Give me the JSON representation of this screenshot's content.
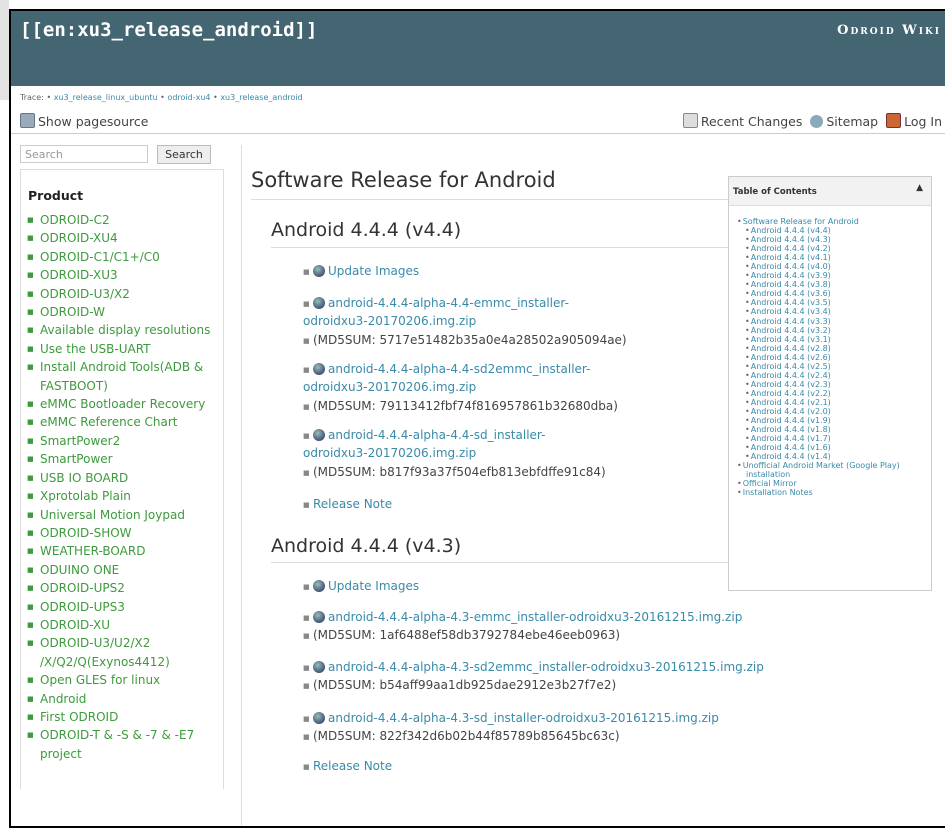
{
  "header": {
    "title": "[[en:xu3_release_android]]",
    "wiki_name": "Odroid Wiki"
  },
  "trace": {
    "label": "Trace:",
    "items": [
      "xu3_release_linux_ubuntu",
      "odroid-xu4",
      "xu3_release_android"
    ]
  },
  "toolbar": {
    "show_pagesource": "Show pagesource",
    "recent_changes": "Recent Changes",
    "sitemap": "Sitemap",
    "log_in": "Log In"
  },
  "search": {
    "placeholder": "Search",
    "button": "Search"
  },
  "sidebar": {
    "heading": "Product",
    "items": [
      "ODROID-C2",
      "ODROID-XU4",
      "ODROID-C1/C1+/C0",
      "ODROID-XU3",
      "ODROID-U3/X2",
      "ODROID-W",
      "Available display resolutions",
      "Use the USB-UART",
      "Install Android Tools(ADB & FASTBOOT)",
      "eMMC Bootloader Recovery",
      "eMMC Reference Chart",
      "SmartPower2",
      "SmartPower",
      "USB IO BOARD",
      "Xprotolab Plain",
      "Universal Motion Joypad",
      "ODROID-SHOW",
      "WEATHER-BOARD",
      "ODUINO ONE",
      "ODROID-UPS2",
      "ODROID-UPS3",
      "ODROID-XU",
      "ODROID-U3/U2/X2 /X/Q2/Q(Exynos4412)",
      "Open GLES for linux",
      "Android",
      "First ODROID",
      "ODROID-T & -S & -7 & -E7 project"
    ]
  },
  "content": {
    "title": "Software Release for Android",
    "sections": [
      {
        "heading": "Android 4.4.4 (v4.4)",
        "update_images": "Update Images",
        "files": [
          {
            "line1": "android-4.4.4-alpha-4.4-emmc_installer-",
            "line2": "odroidxu3-20170206.img.zip",
            "md5": "(MD5SUM: 5717e51482b35a0e4a28502a905094ae)"
          },
          {
            "line1": "android-4.4.4-alpha-4.4-sd2emmc_installer-",
            "line2": "odroidxu3-20170206.img.zip",
            "md5": "(MD5SUM: 79113412fbf74f816957861b32680dba)"
          },
          {
            "line1": "android-4.4.4-alpha-4.4-sd_installer-",
            "line2": "odroidxu3-20170206.img.zip",
            "md5": "(MD5SUM: b817f93a37f504efb813ebfdffe91c84)"
          }
        ],
        "release_note": "Release Note"
      },
      {
        "heading": "Android 4.4.4 (v4.3)",
        "update_images": "Update Images",
        "files": [
          {
            "line1": "android-4.4.4-alpha-4.3-emmc_installer-odroidxu3-20161215.img.zip",
            "md5": "(MD5SUM: 1af6488ef58db3792784ebe46eeb0963)"
          },
          {
            "line1": "android-4.4.4-alpha-4.3-sd2emmc_installer-odroidxu3-20161215.img.zip",
            "md5": "(MD5SUM: b54aff99aa1db925dae2912e3b27f7e2)"
          },
          {
            "line1": "android-4.4.4-alpha-4.3-sd_installer-odroidxu3-20161215.img.zip",
            "md5": "(MD5SUM: 822f342d6b02b44f85789b85645bc63c)"
          }
        ],
        "release_note": "Release Note"
      }
    ]
  },
  "toc": {
    "title": "Table of Contents",
    "toggle": "▲",
    "top": "Software Release for Android",
    "items": [
      "Android 4.4.4 (v4.4)",
      "Android 4.4.4 (v4.3)",
      "Android 4.4.4 (v4.2)",
      "Android 4.4.4 (v4.1)",
      "Android 4.4.4 (v4.0)",
      "Android 4.4.4 (v3.9)",
      "Android 4.4.4 (v3.8)",
      "Android 4.4.4 (v3.6)",
      "Android 4.4.4 (v3.5)",
      "Android 4.4.4 (v3.4)",
      "Android 4.4.4 (v3.3)",
      "Android 4.4.4 (v3.2)",
      "Android 4.4.4 (v3.1)",
      "Android 4.4.4 (v2.8)",
      "Android 4.4.4 (v2.6)",
      "Android 4.4.4 (v2.5)",
      "Android 4.4.4 (v2.4)",
      "Android 4.4.4 (v2.3)",
      "Android 4.4.4 (v2.2)",
      "Android 4.4.4 (v2.1)",
      "Android 4.4.4 (v2.0)",
      "Android 4.4.4 (v1.9)",
      "Android 4.4.4 (v1.8)",
      "Android 4.4.4 (v1.7)",
      "Android 4.4.4 (v1.6)",
      "Android 4.4.4 (v1.4)"
    ],
    "extra": [
      "Unofficial Android Market (Google Play) installation",
      "Official Mirror",
      "Installation Notes"
    ]
  },
  "colors": {
    "header_bg": "#436672",
    "link": "#3a8aa8",
    "sidebar_link": "#3e9a3e"
  }
}
